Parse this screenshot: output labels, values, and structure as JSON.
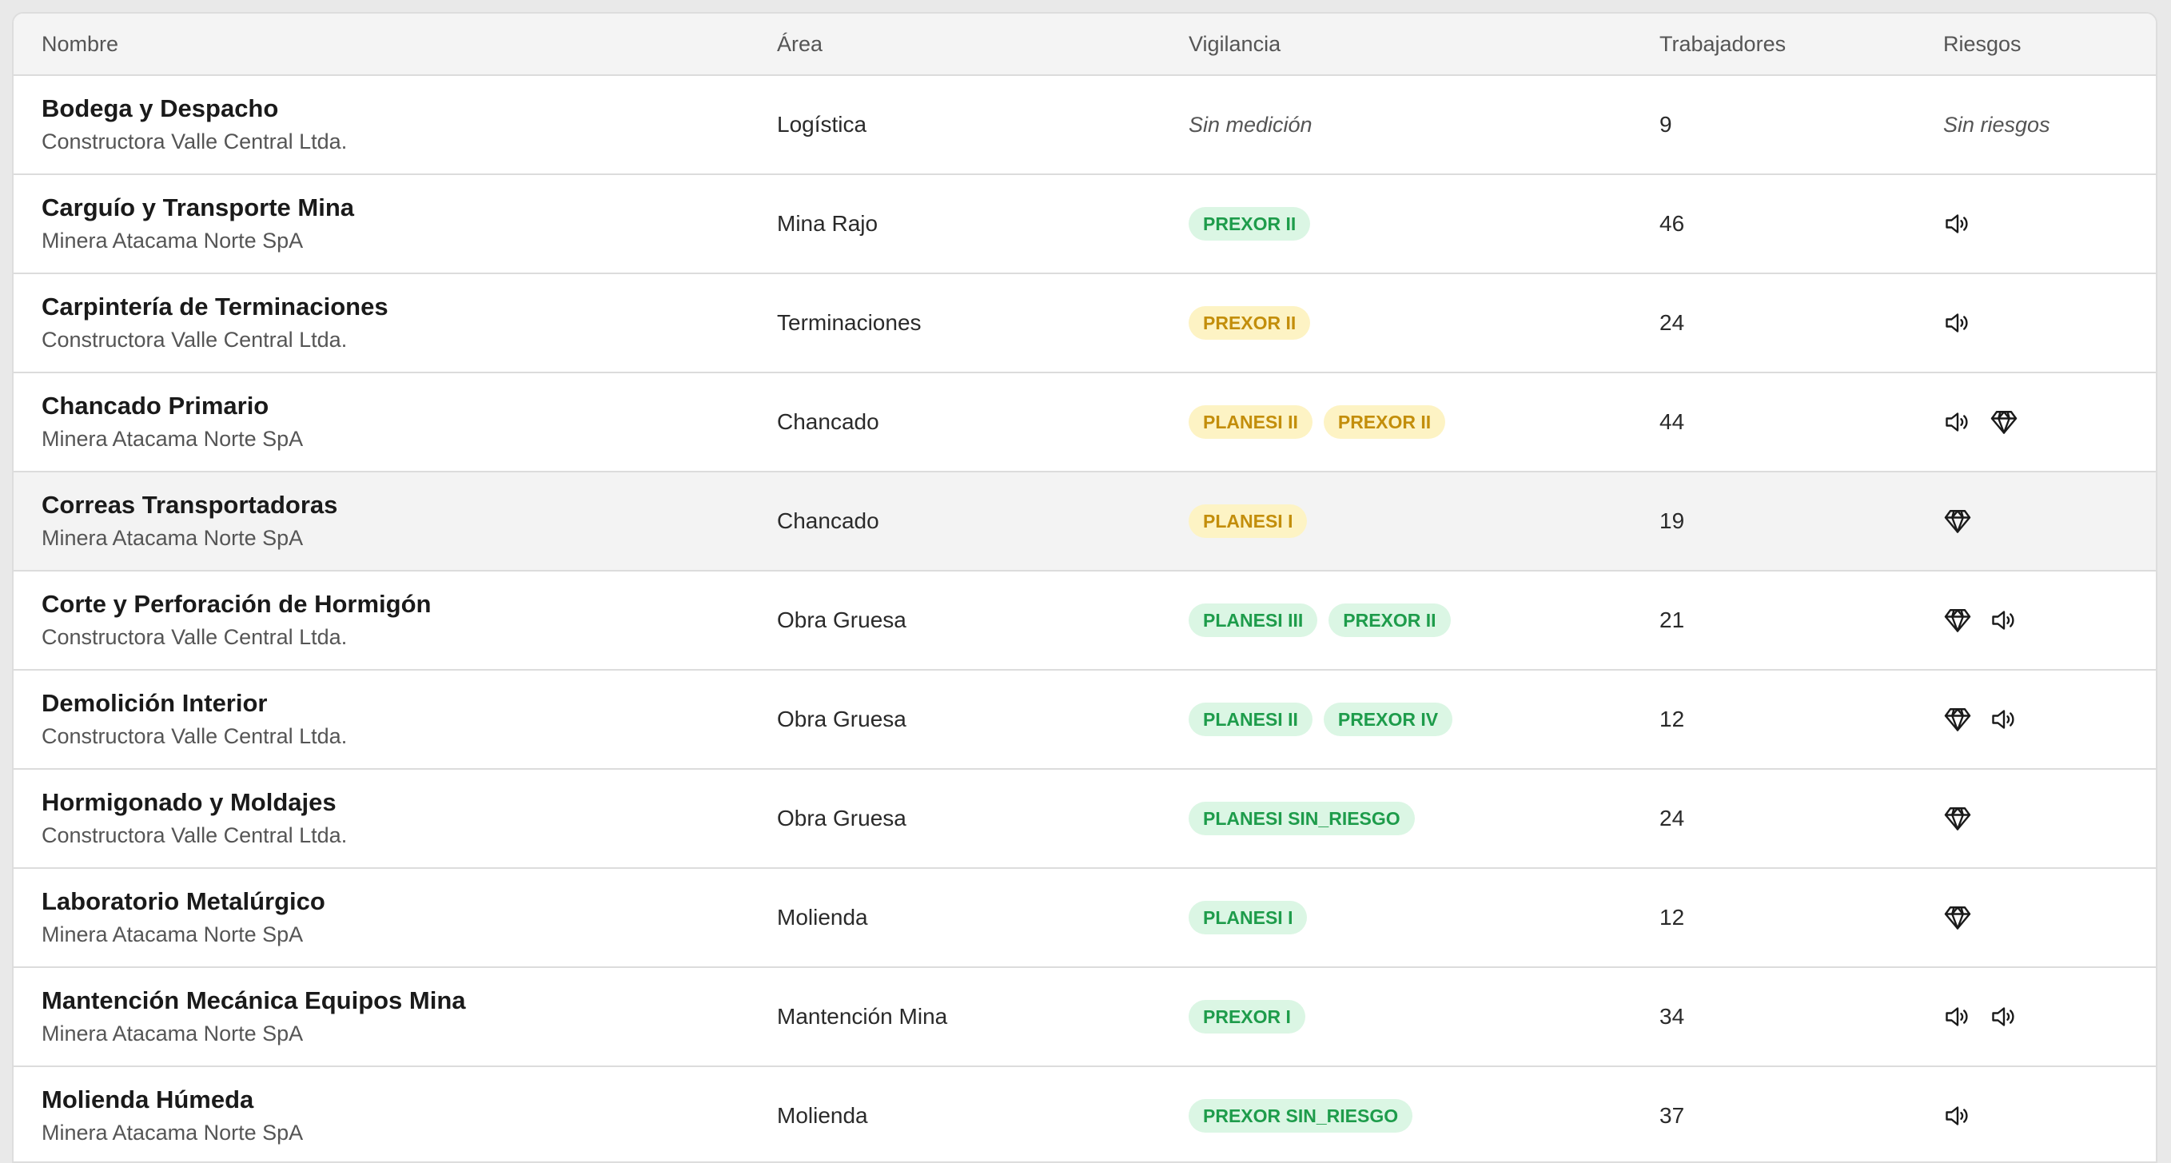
{
  "table": {
    "headers": {
      "name": "Nombre",
      "area": "Área",
      "surveillance": "Vigilancia",
      "workers": "Trabajadores",
      "risks": "Riesgos"
    },
    "rows": [
      {
        "name": "Bodega y Despacho",
        "company": "Constructora Valle Central Ltda.",
        "area": "Logística",
        "surveillance_text": "Sin medición",
        "badges": [],
        "workers": "9",
        "risks_text": "Sin riesgos",
        "risks": []
      },
      {
        "name": "Carguío y Transporte Mina",
        "company": "Minera Atacama Norte SpA",
        "area": "Mina Rajo",
        "surveillance_text": "",
        "badges": [
          {
            "label": "PREXOR II",
            "color": "green"
          }
        ],
        "workers": "46",
        "risks_text": "",
        "risks": [
          "speaker-icon"
        ]
      },
      {
        "name": "Carpintería de Terminaciones",
        "company": "Constructora Valle Central Ltda.",
        "area": "Terminaciones",
        "surveillance_text": "",
        "badges": [
          {
            "label": "PREXOR II",
            "color": "yellow"
          }
        ],
        "workers": "24",
        "risks_text": "",
        "risks": [
          "speaker-icon"
        ]
      },
      {
        "name": "Chancado Primario",
        "company": "Minera Atacama Norte SpA",
        "area": "Chancado",
        "surveillance_text": "",
        "badges": [
          {
            "label": "PLANESI II",
            "color": "yellow"
          },
          {
            "label": "PREXOR II",
            "color": "yellow"
          }
        ],
        "workers": "44",
        "risks_text": "",
        "risks": [
          "speaker-icon",
          "diamond-icon"
        ]
      },
      {
        "name": "Correas Transportadoras",
        "company": "Minera Atacama Norte SpA",
        "area": "Chancado",
        "surveillance_text": "",
        "badges": [
          {
            "label": "PLANESI I",
            "color": "yellow"
          }
        ],
        "workers": "19",
        "risks_text": "",
        "risks": [
          "diamond-icon"
        ]
      },
      {
        "name": "Corte y Perforación de Hormigón",
        "company": "Constructora Valle Central Ltda.",
        "area": "Obra Gruesa",
        "surveillance_text": "",
        "badges": [
          {
            "label": "PLANESI III",
            "color": "green"
          },
          {
            "label": "PREXOR II",
            "color": "green"
          }
        ],
        "workers": "21",
        "risks_text": "",
        "risks": [
          "diamond-icon",
          "speaker-icon"
        ]
      },
      {
        "name": "Demolición Interior",
        "company": "Constructora Valle Central Ltda.",
        "area": "Obra Gruesa",
        "surveillance_text": "",
        "badges": [
          {
            "label": "PLANESI II",
            "color": "green"
          },
          {
            "label": "PREXOR IV",
            "color": "green"
          }
        ],
        "workers": "12",
        "risks_text": "",
        "risks": [
          "diamond-icon",
          "speaker-icon"
        ]
      },
      {
        "name": "Hormigonado y Moldajes",
        "company": "Constructora Valle Central Ltda.",
        "area": "Obra Gruesa",
        "surveillance_text": "",
        "badges": [
          {
            "label": "PLANESI SIN_RIESGO",
            "color": "green"
          }
        ],
        "workers": "24",
        "risks_text": "",
        "risks": [
          "diamond-icon"
        ]
      },
      {
        "name": "Laboratorio Metalúrgico",
        "company": "Minera Atacama Norte SpA",
        "area": "Molienda",
        "surveillance_text": "",
        "badges": [
          {
            "label": "PLANESI I",
            "color": "green"
          }
        ],
        "workers": "12",
        "risks_text": "",
        "risks": [
          "diamond-icon"
        ]
      },
      {
        "name": "Mantención Mecánica Equipos Mina",
        "company": "Minera Atacama Norte SpA",
        "area": "Mantención Mina",
        "surveillance_text": "",
        "badges": [
          {
            "label": "PREXOR I",
            "color": "green"
          }
        ],
        "workers": "34",
        "risks_text": "",
        "risks": [
          "speaker-icon",
          "speaker-icon"
        ]
      },
      {
        "name": "Molienda Húmeda",
        "company": "Minera Atacama Norte SpA",
        "area": "Molienda",
        "surveillance_text": "",
        "badges": [
          {
            "label": "PREXOR SIN_RIESGO",
            "color": "green"
          }
        ],
        "workers": "37",
        "risks_text": "",
        "risks": [
          "speaker-icon"
        ]
      }
    ]
  },
  "colors": {
    "badge_green_bg": "#dbf6e4",
    "badge_green_text": "#1e9c4b",
    "badge_yellow_bg": "#fdf3c4",
    "badge_yellow_text": "#c38e0b"
  }
}
